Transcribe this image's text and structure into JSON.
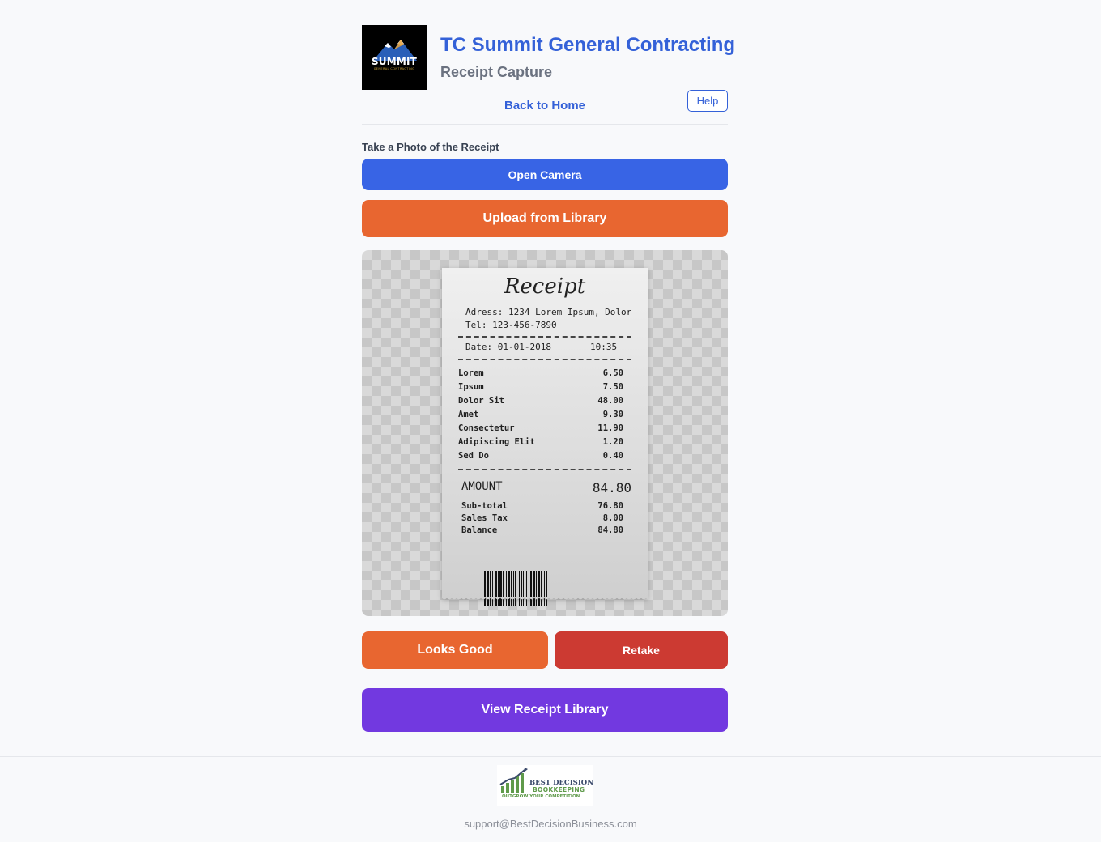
{
  "header": {
    "logo": {
      "word": "SUMMIT",
      "tagline": "GENERAL CONTRACTING"
    },
    "company_name": "TC Summit General Contracting",
    "subtitle": "Receipt Capture",
    "back_link": "Back to Home",
    "help_label": "Help"
  },
  "capture": {
    "section_label": "Take a Photo of the Receipt",
    "open_camera_label": "Open Camera",
    "upload_label": "Upload from Library"
  },
  "receipt": {
    "title": "Receipt",
    "address": "Adress: 1234 Lorem Ipsum, Dolor",
    "tel": "Tel: 123-456-7890",
    "date": "Date: 01-01-2018",
    "time": "10:35",
    "items": [
      {
        "name": "Lorem",
        "price": "6.50"
      },
      {
        "name": "Ipsum",
        "price": "7.50"
      },
      {
        "name": "Dolor Sit",
        "price": "48.00"
      },
      {
        "name": "Amet",
        "price": "9.30"
      },
      {
        "name": "Consectetur",
        "price": "11.90"
      },
      {
        "name": "Adipiscing Elit",
        "price": "1.20"
      },
      {
        "name": "Sed Do",
        "price": "0.40"
      }
    ],
    "amount_label": "AMOUNT",
    "amount_value": "84.80",
    "totals": [
      {
        "name": "Sub-total",
        "value": "76.80"
      },
      {
        "name": "Sales Tax",
        "value": "8.00"
      },
      {
        "name": "Balance",
        "value": "84.80"
      }
    ]
  },
  "actions": {
    "looks_good_label": "Looks Good",
    "retake_label": "Retake",
    "view_library_label": "View Receipt Library"
  },
  "footer": {
    "brand_line1": "BEST DECISION",
    "brand_line2": "BOOKKEEPING",
    "brand_tagline": "OUTGROW YOUR COMPETITION",
    "support_email": "support@BestDecisionBusiness.com"
  },
  "colors": {
    "primary_blue": "#3864e5",
    "orange": "#e86630",
    "red": "#cc3a32",
    "purple": "#7239e0"
  }
}
